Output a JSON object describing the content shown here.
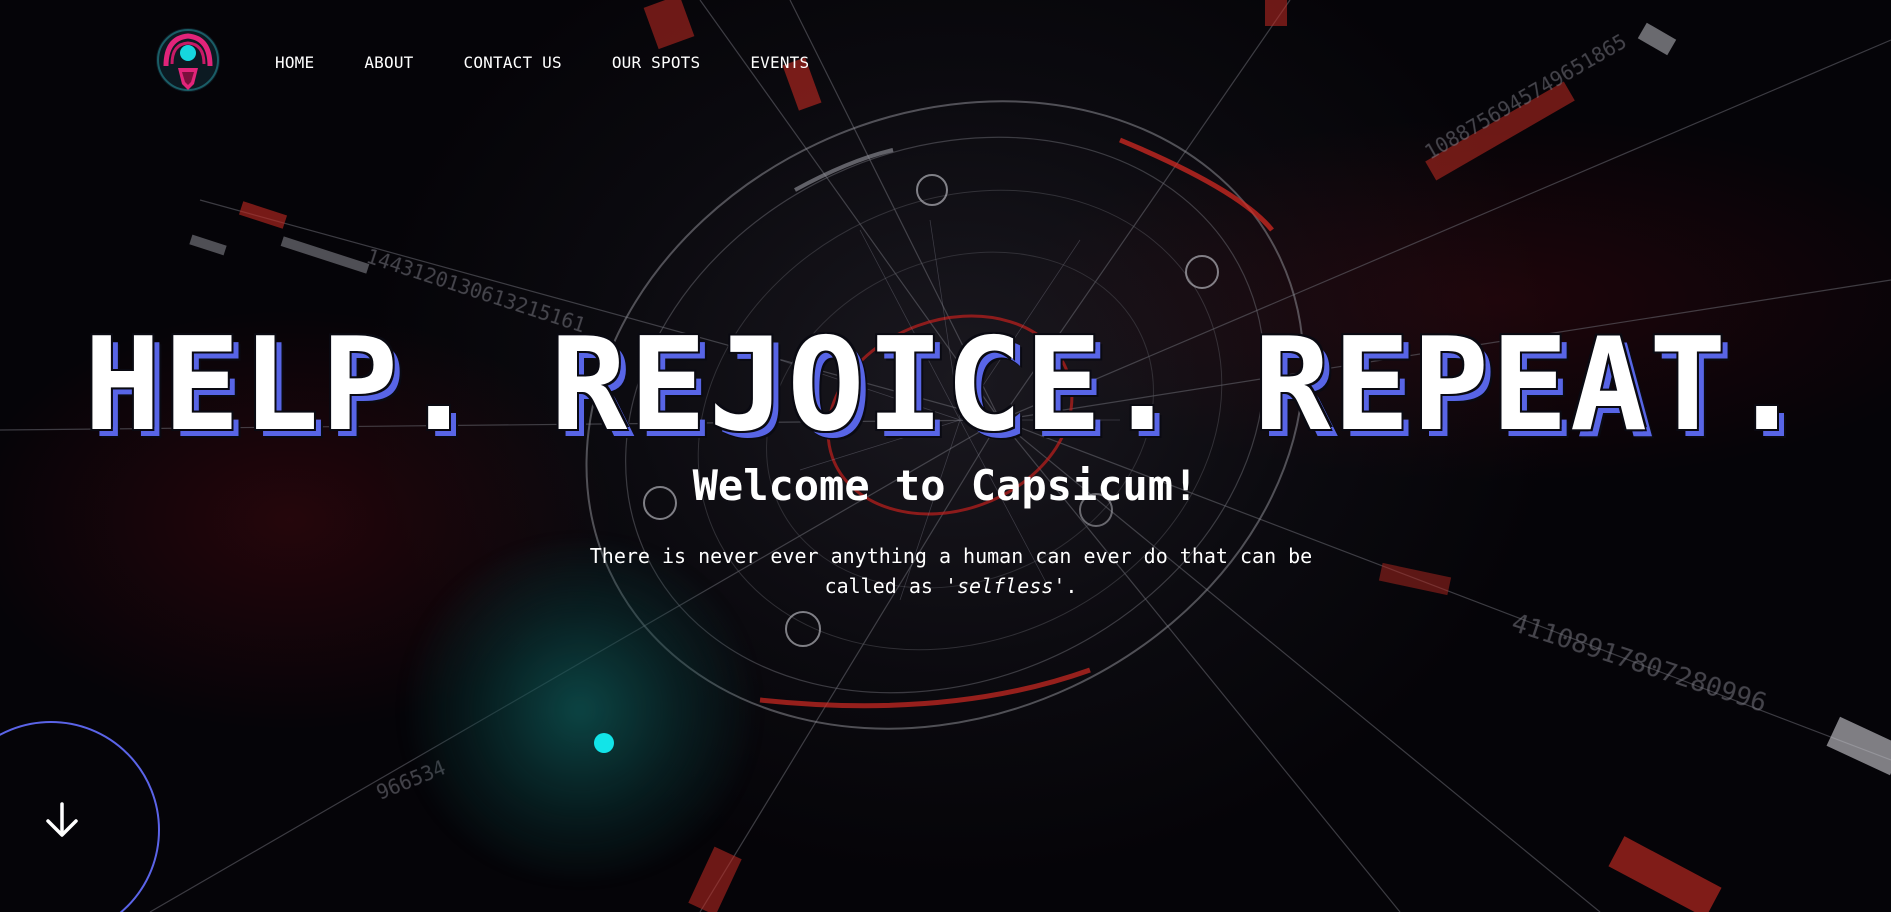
{
  "nav": {
    "items": [
      {
        "label": "HOME"
      },
      {
        "label": "ABOUT"
      },
      {
        "label": "CONTACT US"
      },
      {
        "label": "OUR SPOTS"
      },
      {
        "label": "EVENTS"
      }
    ]
  },
  "hero": {
    "title": "HELP. REJOICE. REPEAT.",
    "subtitle": "Welcome to Capsicum!",
    "text_before": "There is never ever anything a human can ever do that can be called as '",
    "text_emphasis": "selfless",
    "text_after": "'."
  },
  "background_numbers": {
    "a": "1443120130613215161",
    "b": "1088756945749651865",
    "c": "41108917807280996",
    "d": "966534"
  },
  "colors": {
    "accent_blue": "#5865e6",
    "accent_teal": "#12e4e8",
    "accent_red": "#e0281f",
    "logo_pink": "#e2247a"
  },
  "icons": {
    "logo": "capsicum-logo",
    "scroll": "arrow-down-icon"
  }
}
